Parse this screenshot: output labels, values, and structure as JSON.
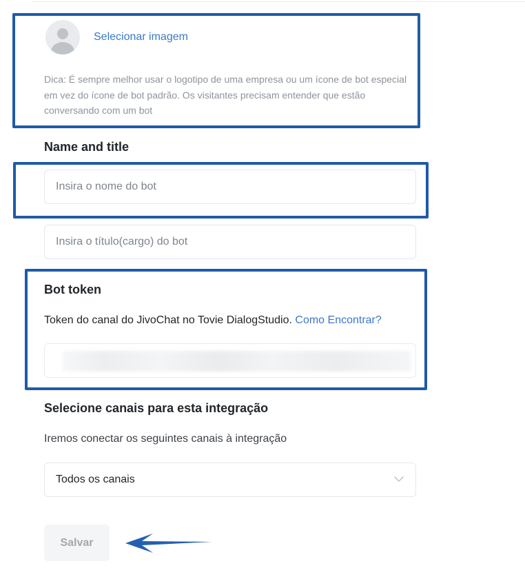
{
  "avatar_section": {
    "select_image_label": "Selecionar imagem",
    "hint": "Dica: É sempre melhor usar o logotipo de uma empresa ou um ícone de bot especial em vez do ícone de bot padrão. Os visitantes precisam entender que estão conversando com um bot"
  },
  "name_section": {
    "heading": "Name and title",
    "name_placeholder": "Insira o nome do bot",
    "title_placeholder": "Insira o título(cargo) do bot"
  },
  "token_section": {
    "heading": "Bot token",
    "description": "Token do canal do JivoChat no Tovie DialogStudio.",
    "help_link": "Como Encontrar?"
  },
  "channels_section": {
    "heading": "Selecione canais para esta integração",
    "description": "Iremos conectar os seguintes canais à integração",
    "selected": "Todos os canais"
  },
  "actions": {
    "save_label": "Salvar"
  },
  "colors": {
    "highlight": "#1f5aa8",
    "link": "#3a78c9",
    "arrow": "#2560b0"
  }
}
